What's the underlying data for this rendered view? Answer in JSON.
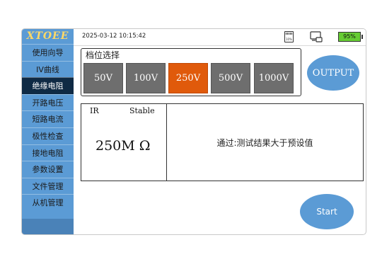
{
  "app": {
    "logo": "XTOEE"
  },
  "sidebar": {
    "items": [
      {
        "label": "使用向导"
      },
      {
        "label": "IV曲线"
      },
      {
        "label": "绝缘电阻"
      },
      {
        "label": "开路电压"
      },
      {
        "label": "短路电流"
      },
      {
        "label": "极性检查"
      },
      {
        "label": "接地电阻"
      },
      {
        "label": "参数设置"
      },
      {
        "label": "文件管理"
      },
      {
        "label": "从机管理"
      }
    ],
    "active_index": 2
  },
  "status_bar": {
    "datetime": "2025-03-12 10:15:42",
    "sd_label": "10%",
    "battery": "95%",
    "battery_color": "#66cc33"
  },
  "gear": {
    "title": "档位选择",
    "options": [
      "50V",
      "100V",
      "250V",
      "500V",
      "1000V"
    ],
    "selected": "250V"
  },
  "output_button": "OUTPUT",
  "result": {
    "ir_label": "IR",
    "stable_label": "Stable",
    "value": "250M Ω",
    "message": "通过:测试结果大于预设值"
  },
  "start_button": "Start",
  "colors": {
    "accent": "#5b9bd5",
    "selected": "#e05a0b",
    "nav_active": "#0f2a44",
    "button_gray": "#6e6e6e"
  }
}
